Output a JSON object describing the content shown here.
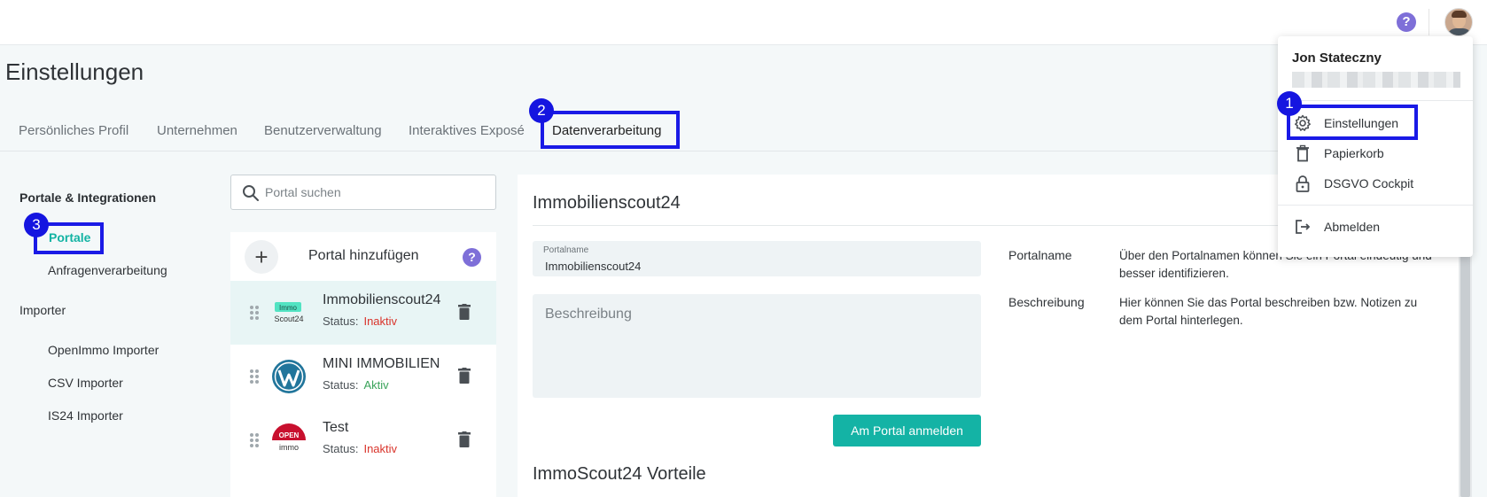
{
  "page": {
    "title": "Einstellungen"
  },
  "header": {
    "help_icon": "help-icon",
    "help_char": "?",
    "avatar_icon": "user-avatar"
  },
  "tabs": [
    {
      "label": "Persönliches Profil",
      "active": false
    },
    {
      "label": "Unternehmen",
      "active": false
    },
    {
      "label": "Benutzerverwaltung",
      "active": false
    },
    {
      "label": "Interaktives Exposé",
      "active": false
    },
    {
      "label": "Datenverarbeitung",
      "active": true
    }
  ],
  "sidebar": {
    "heading": "Portale & Integrationen",
    "items": [
      {
        "label": "Portale",
        "active": true
      },
      {
        "label": "Anfragenverarbeitung",
        "active": false
      }
    ],
    "section2": "Importer",
    "importers": [
      {
        "label": "OpenImmo Importer"
      },
      {
        "label": "CSV Importer"
      },
      {
        "label": "IS24 Importer"
      }
    ]
  },
  "search": {
    "placeholder": "Portal suchen"
  },
  "portals": {
    "add_label": "Portal hinzufügen",
    "add_char": "+",
    "help_char": "?",
    "status_prefix": "Status:",
    "items": [
      {
        "name": "Immobilienscout24",
        "status": "Inaktiv",
        "logo": "immoscout24-logo",
        "selected": true
      },
      {
        "name": "MINI IMMOBILIEN",
        "status": "Aktiv",
        "logo": "wordpress-logo",
        "selected": false
      },
      {
        "name": "Test",
        "status": "Inaktiv",
        "logo": "openimmo-logo",
        "selected": false
      }
    ]
  },
  "logos": {
    "immoscout": {
      "line1": "Immo",
      "line2": "Scout24"
    },
    "openimmo": {
      "line1": "OPEN",
      "line2": "immo"
    }
  },
  "detail": {
    "title": "Immobilienscout24",
    "portalname_label": "Portalname",
    "portalname_value": "Immobilienscout24",
    "description_placeholder": "Beschreibung",
    "info": [
      {
        "label": "Portalname",
        "text": "Über den Portalnamen können Sie ein Portal eindeutig und besser identifizieren."
      },
      {
        "label": "Beschreibung",
        "text": "Hier können Sie das Portal beschreiben bzw. Notizen zu dem Portal hinterlegen."
      }
    ],
    "connect_button": "Am Portal anmelden",
    "subtitle": "ImmoScout24 Vorteile"
  },
  "user_menu": {
    "name": "Jon Stateczny",
    "items": [
      {
        "label": "Einstellungen",
        "icon": "gear-icon"
      },
      {
        "label": "Papierkorb",
        "icon": "trash-icon"
      },
      {
        "label": "DSGVO Cockpit",
        "icon": "lock-icon"
      },
      {
        "label": "Abmelden",
        "icon": "logout-icon"
      }
    ]
  },
  "annotations": [
    "1",
    "2",
    "3"
  ],
  "colors": {
    "accent": "#14b3a5",
    "inactive": "#d9342b",
    "active": "#3aa35a",
    "highlight": "#1a1ae6",
    "help": "#7e6fd8"
  }
}
